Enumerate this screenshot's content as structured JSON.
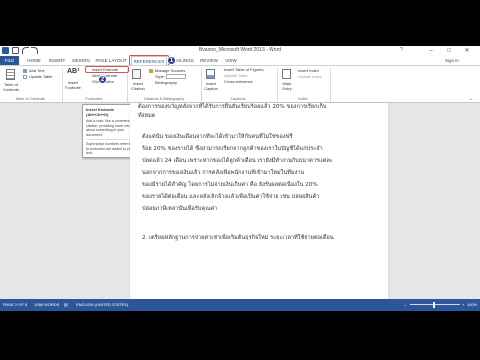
{
  "window": {
    "title": "Bvaono_Microsoft Word 2013 - Word",
    "help": "?",
    "min": "–",
    "max": "□",
    "close": "✕"
  },
  "tabs": [
    "FILE",
    "HOME",
    "INSERT",
    "DESIGN",
    "PAGE LAYOUT",
    "REFERENCES",
    "MAILINGS",
    "REVIEW",
    "VIEW"
  ],
  "signin": "Sign in",
  "ribbon": {
    "toc": {
      "big_label": "Table of Contents",
      "add_text": "Add Text",
      "update_table": "Update Table",
      "group": "Table of Contents"
    },
    "footnotes": {
      "big_label": "Insert Footnote",
      "insert_endnote": "Insert Endnote",
      "next_footnote": "Next Footnote",
      "show_notes": "Show Notes",
      "group": "Footnotes"
    },
    "citations": {
      "big_label": "Insert Citation",
      "manage_sources": "Manage Sources",
      "style": "Style:",
      "bibliography": "Bibliography",
      "group": "Citations & Bibliography"
    },
    "captions": {
      "big_label": "Insert Caption",
      "insert_table_of_figures": "Insert Table of Figures",
      "update_table": "Update Table",
      "cross_reference": "Cross-reference",
      "group": "Captions"
    },
    "index": {
      "big_label": "Mark Entry",
      "insert_index": "Insert Index",
      "update_index": "Update Index",
      "group": "Index"
    }
  },
  "markers": [
    "1",
    "2"
  ],
  "tooltip": {
    "title": "Insert Endnote (Alt+Ctrl+D)",
    "body": "Add a note, like a comment or citation, providing more info about something in your document.",
    "extra": "Superscript numbers referring to endnotes are added to your text."
  },
  "document": {
    "lines": [
      "ต้องการของขวัญหลังจากที่ได้รับการยืนยันเรียบร้อยแล้ว 20% ของการเรียกเก็บ",
      "ทั้งหมด",
      "ตั้งแต่นั้น ของเงินเดือนจากที่จะได้เข้ามาให้กับคนที่ไม่ใช่ของฟรี",
      "ร้อย 20% ของรายได้ ซึ่งสามารถเรียกจากลูกค้าของเราในบัญชีได้แก่ประจำ",
      "ปลดแล้ว 24 เดือน เพราะหากของได้ลูกค้าเดือน เรายังมีทำงานกับธนาคารแต่ละ",
      "นอกจากการของเงินแล้ว การคลังเพื่อพนักงานที่เข้ามาใหม่ในทีมงาน",
      "ของมีรายได้สำคัญ โดยการไม่จ่ายเงินเก็บค่า คือ ยังรับผลต่อเนื่องใน 20%",
      "ของรายได้ต่อเดือน และหลังเลิกจ้างแล้วเพื่อเป็นค่าใช้จ่าย เช่น ปล่อยสินค้า",
      "ปล่อยภาษีเหล่านั้นเพื่อรับคุณค่า",
      "2. เตรียมหลักฐานการจ่ายค่าเช่าเพื่อเริ่มต้นธุรกิจใหม่ ระยะเวลาที่ใช้จ่ายต่อเดือน"
    ]
  },
  "status": {
    "page": "PAGE 2 OF 8",
    "words": "1088 WORDS",
    "lang": "ENGLISH (UNITED STATES)",
    "zoom_minus": "–",
    "zoom_plus": "+",
    "zoom": "100%"
  },
  "colors": {
    "accent": "#2b579a",
    "highlight": "#d9534f",
    "marker": "#1f3f8f"
  }
}
